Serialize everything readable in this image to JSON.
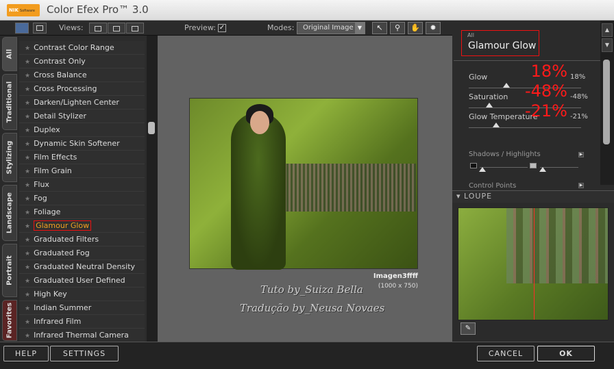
{
  "app": {
    "logo_text": "NIK",
    "logo_sub": "Software",
    "title": "Color Efex Pro™ 3.0"
  },
  "toolbar": {
    "views_label": "Views:",
    "preview_label": "Preview:",
    "preview_checked": true,
    "modes_label": "Modes:",
    "modes_value": "Original Image",
    "tools": [
      "arrow-icon",
      "zoom-icon",
      "hand-icon",
      "light-icon"
    ]
  },
  "tabs": [
    "All",
    "Traditional",
    "Stylizing",
    "Landscape",
    "Portrait",
    "Favorites"
  ],
  "filters": [
    "Contrast Color Range",
    "Contrast Only",
    "Cross Balance",
    "Cross Processing",
    "Darken/Lighten Center",
    "Detail Stylizer",
    "Duplex",
    "Dynamic Skin Softener",
    "Film Effects",
    "Film Grain",
    "Flux",
    "Fog",
    "Foliage",
    "Glamour Glow",
    "Graduated Filters",
    "Graduated Fog",
    "Graduated Neutral Density",
    "Graduated User Defined",
    "High Key",
    "Indian Summer",
    "Infrared Film",
    "Infrared Thermal Camera"
  ],
  "selected_filter": "Glamour Glow",
  "preview": {
    "image_name": "Imagen3ffff",
    "image_size": "(1000 x 750)",
    "watermark_1": "Tuto by_Suiza Bella",
    "watermark_2": "Tradução by_Neusa Novaes"
  },
  "panel": {
    "category": "All",
    "filter_title": "Glamour Glow",
    "sliders": [
      {
        "label": "Glow",
        "big": "18%",
        "small": "18%",
        "value": 18
      },
      {
        "label": "Saturation",
        "big": "-48%",
        "small": "-48%",
        "value": -48
      },
      {
        "label": "Glow Temperature",
        "big": "-21%",
        "small": "-21%",
        "value": -21
      }
    ],
    "shadows_label": "Shadows / Highlights",
    "control_points_label": "Control Points",
    "loupe_label": "LOUPE"
  },
  "footer": {
    "help": "HELP",
    "settings": "SETTINGS",
    "cancel": "CANCEL",
    "ok": "OK"
  }
}
